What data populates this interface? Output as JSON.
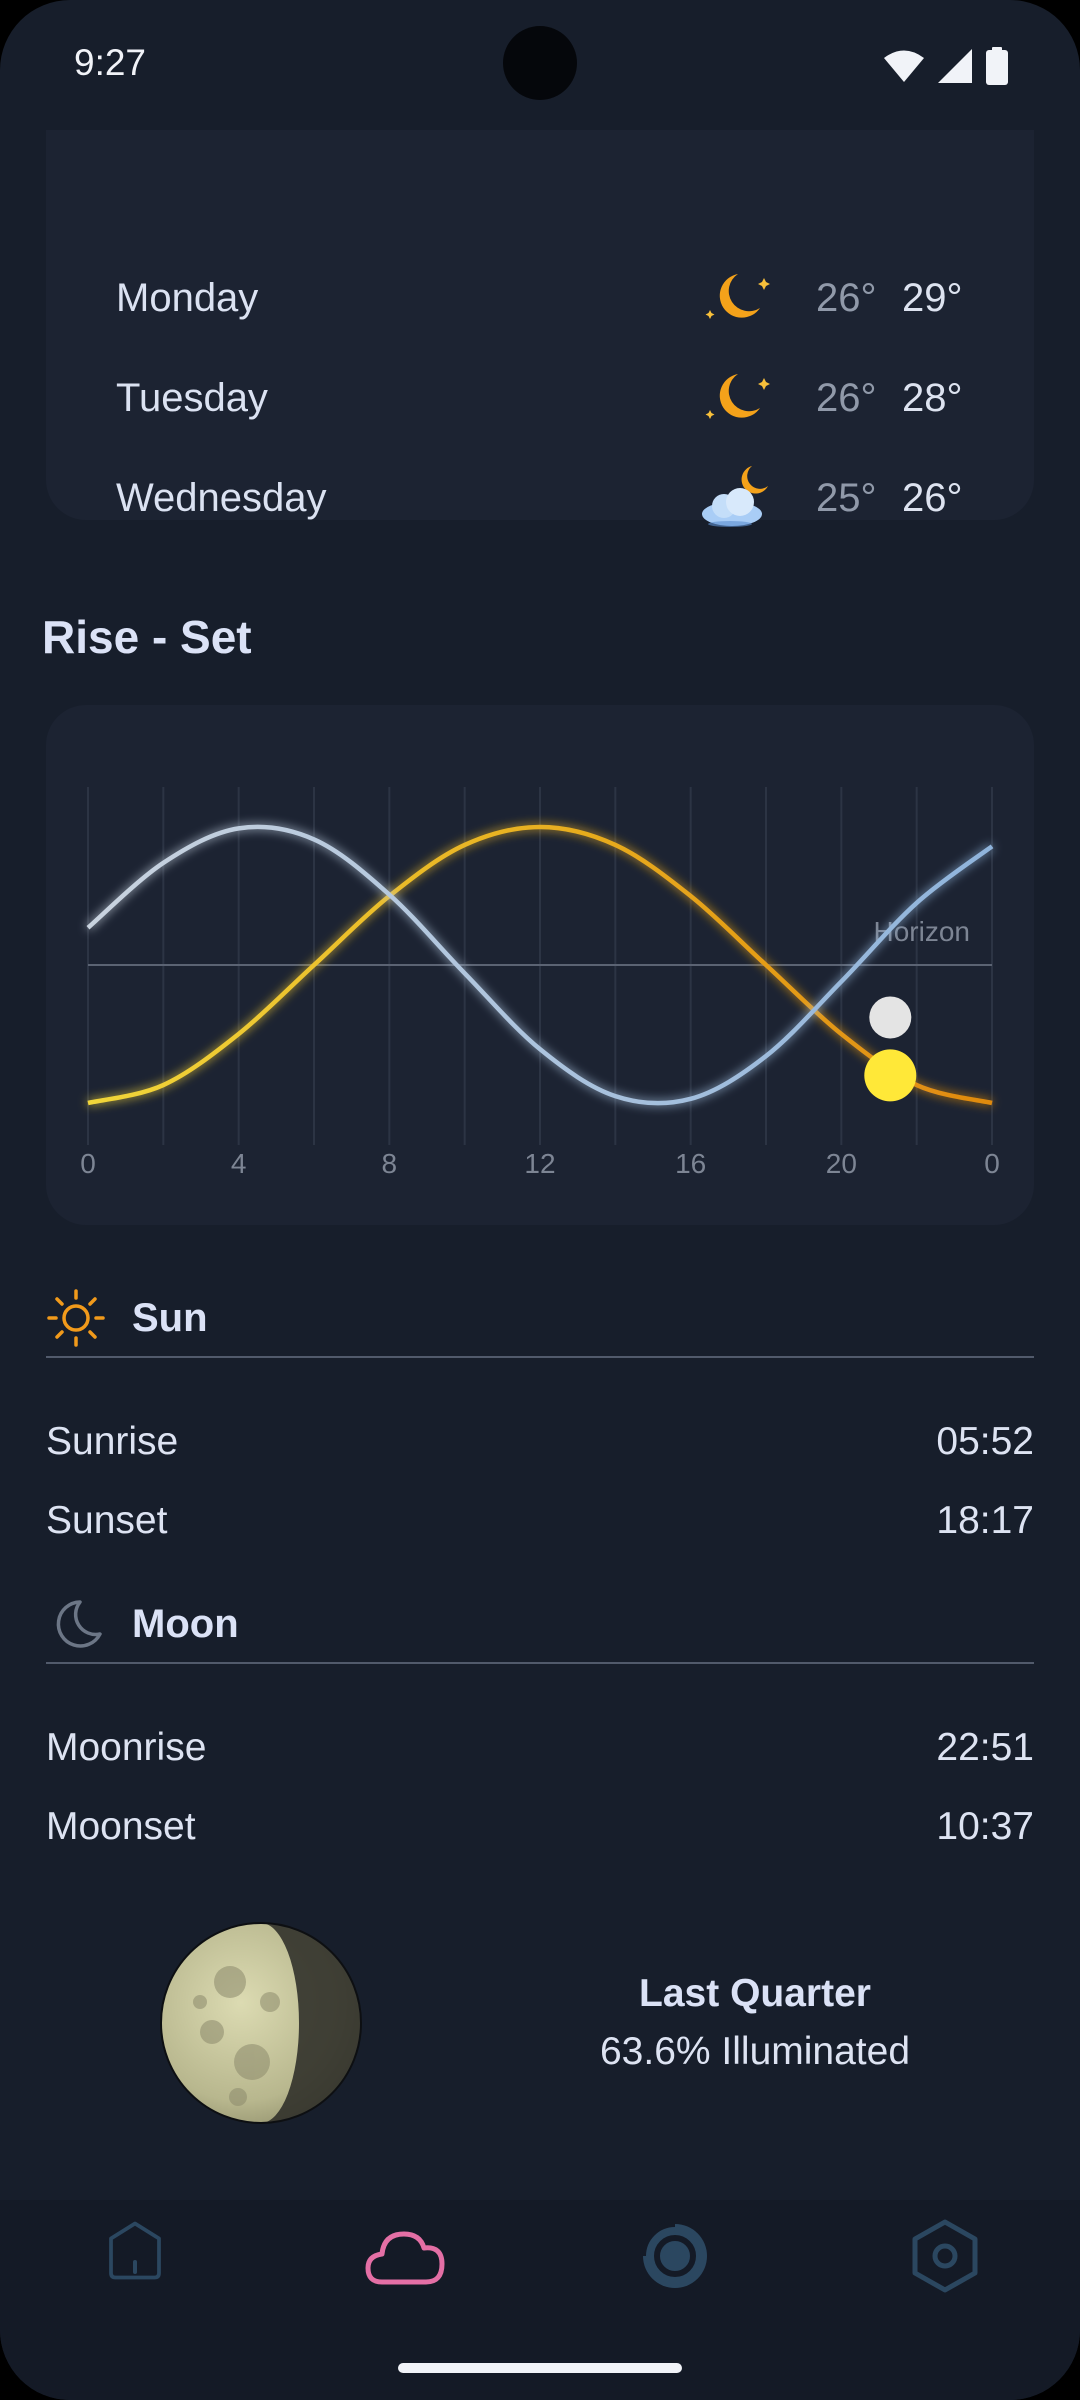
{
  "status_bar": {
    "time": "9:27"
  },
  "forecast": [
    {
      "day": "Monday",
      "icon": "clear-night-icon",
      "low": "26°",
      "high": "29°"
    },
    {
      "day": "Tuesday",
      "icon": "clear-night-icon",
      "low": "26°",
      "high": "28°"
    },
    {
      "day": "Wednesday",
      "icon": "partly-cloudy-night-icon",
      "low": "25°",
      "high": "26°"
    }
  ],
  "rise_set": {
    "title": "Rise - Set",
    "horizon_label": "Horizon"
  },
  "chart_data": {
    "type": "line",
    "title": "",
    "xlabel": "",
    "ylabel": "",
    "x_ticks": [
      "0",
      "4",
      "8",
      "12",
      "16",
      "20",
      "0"
    ],
    "xlim": [
      0,
      24
    ],
    "ylim": [
      -1,
      1
    ],
    "horizon": 0,
    "grid": "vertical every 2 hours",
    "series": [
      {
        "color": "#e6a81c",
        "x": [
          0,
          2,
          4,
          6,
          8,
          10,
          12,
          14,
          16,
          18,
          20,
          22,
          24
        ],
        "y": [
          -1,
          -0.87,
          -0.5,
          0,
          0.5,
          0.87,
          1,
          0.87,
          0.5,
          0,
          -0.5,
          -0.87,
          -1
        ]
      },
      {
        "color": "#b0c4dc",
        "x": [
          0,
          2,
          4,
          6,
          8,
          10,
          12,
          14,
          16,
          18,
          20,
          22,
          24
        ],
        "y": [
          0.27,
          0.74,
          0.99,
          0.91,
          0.51,
          -0.06,
          -0.61,
          -0.95,
          -0.97,
          -0.66,
          -0.12,
          0.45,
          0.86
        ]
      }
    ],
    "markers": [
      {
        "name": "sun-marker",
        "x": 21.3,
        "y": -0.8,
        "color": "#ffe838"
      },
      {
        "name": "moon-marker",
        "x": 21.3,
        "y": -0.38,
        "color": "#e4e4e4"
      }
    ]
  },
  "sun": {
    "title": "Sun",
    "rows": [
      {
        "label": "Sunrise",
        "value": "05:52"
      },
      {
        "label": "Sunset",
        "value": "18:17"
      }
    ]
  },
  "moon": {
    "title": "Moon",
    "rows": [
      {
        "label": "Moonrise",
        "value": "22:51"
      },
      {
        "label": "Moonset",
        "value": "10:37"
      }
    ],
    "phase": "Last Quarter",
    "illumination": "63.6% Illuminated"
  },
  "nav": [
    {
      "icon": "home-icon",
      "active": false
    },
    {
      "icon": "cloud-icon",
      "active": true,
      "color": "#e46fa5"
    },
    {
      "icon": "radar-icon",
      "active": false
    },
    {
      "icon": "settings-icon",
      "active": false
    }
  ]
}
